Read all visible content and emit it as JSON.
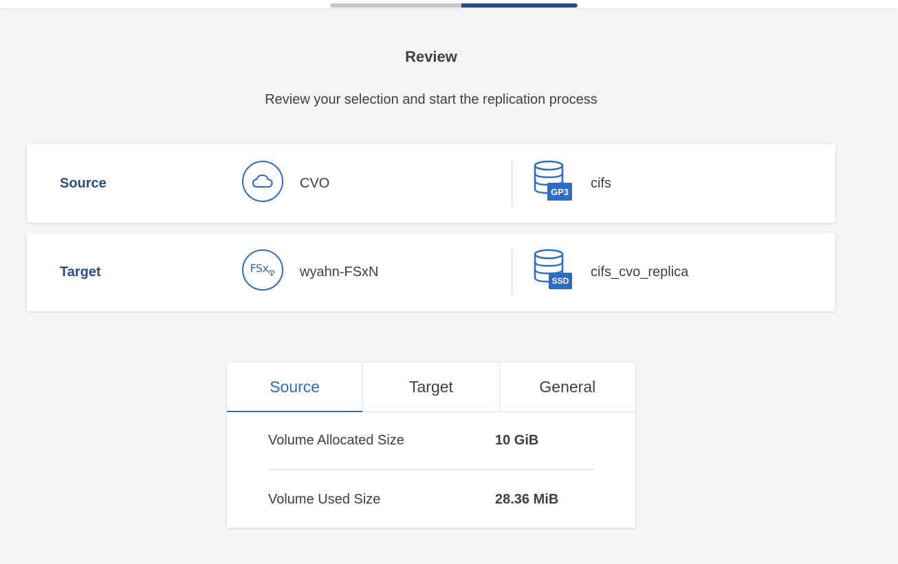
{
  "wizard": {
    "progress_fraction": 0.47,
    "title": "Review",
    "subtitle": "Review your selection and start the replication process"
  },
  "rows": {
    "source": {
      "label": "Source",
      "environment": "CVO",
      "environment_icon": "cloud-icon",
      "volume": "cifs",
      "volume_badge": "GP3"
    },
    "target": {
      "label": "Target",
      "environment": "wyahn-FSxN",
      "environment_icon_text": "FSx",
      "volume": "cifs_cvo_replica",
      "volume_badge": "SSD"
    }
  },
  "details": {
    "tabs": [
      {
        "label": "Source",
        "active": true
      },
      {
        "label": "Target",
        "active": false
      },
      {
        "label": "General",
        "active": false
      }
    ],
    "items": [
      {
        "label": "Volume Allocated Size",
        "value": "10 GiB"
      },
      {
        "label": "Volume Used Size",
        "value": "28.36 MiB"
      }
    ]
  },
  "colors": {
    "accent": "#2e6bc4",
    "label_blue": "#2b4a8b",
    "progress_fill": "#2b4a8b",
    "progress_track": "#c8c8c8",
    "background": "#f5f5f5"
  }
}
